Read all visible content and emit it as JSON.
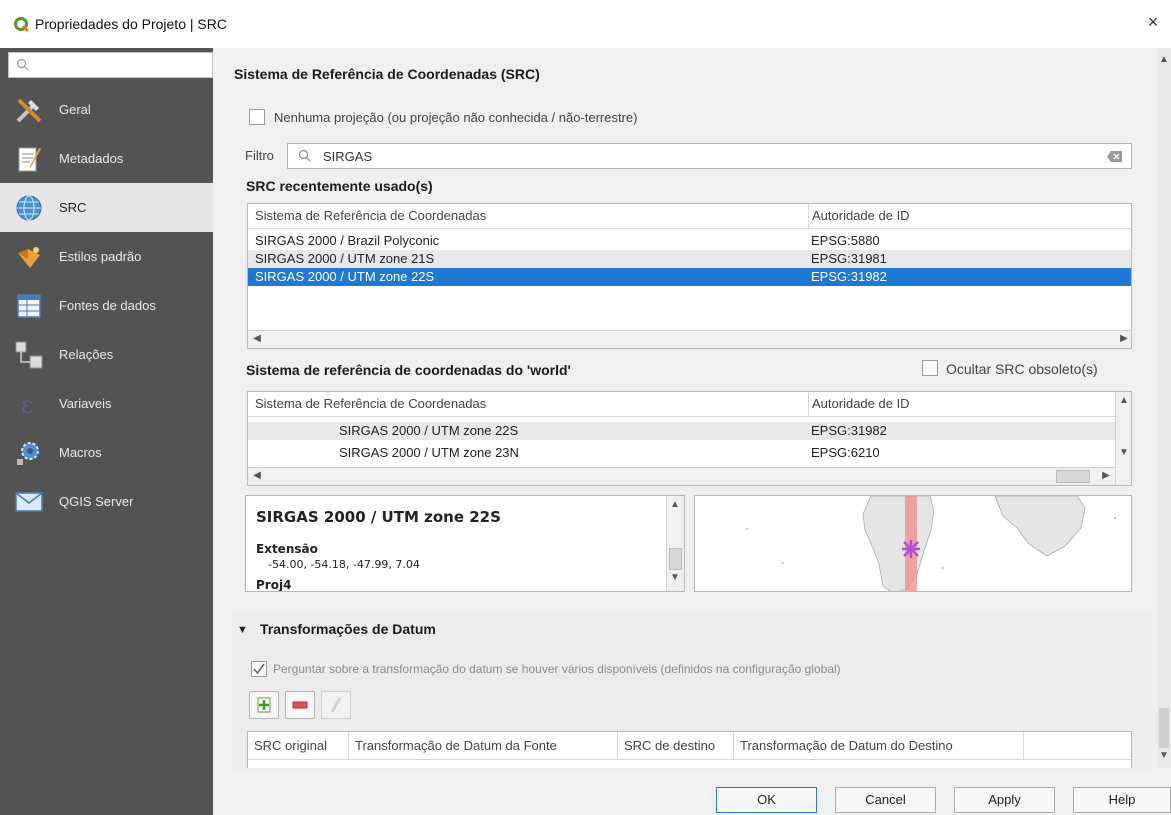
{
  "window": {
    "title": "Propriedades do Projeto | SRC",
    "close_label": "×"
  },
  "sidebar": {
    "items": [
      {
        "label": "Geral",
        "icon": "tools-icon"
      },
      {
        "label": "Metadados",
        "icon": "document-pen-icon"
      },
      {
        "label": "SRC",
        "icon": "globe-icon",
        "active": true
      },
      {
        "label": "Estilos padrão",
        "icon": "paint-icon"
      },
      {
        "label": "Fontes de dados",
        "icon": "table-icon"
      },
      {
        "label": "Relações",
        "icon": "relations-icon"
      },
      {
        "label": "Variaveis",
        "icon": "epsilon-icon"
      },
      {
        "label": "Macros",
        "icon": "gear-icon"
      },
      {
        "label": "QGIS Server",
        "icon": "server-icon"
      }
    ]
  },
  "src": {
    "section_title": "Sistema de Referência de Coordenadas (SRC)",
    "no_projection_label": "Nenhuma projeção (ou projeção não conhecida / não-terrestre)",
    "filter_label": "Filtro",
    "filter_value": "SIRGAS",
    "recent_title": "SRC recentemente usado(s)",
    "recent_columns": [
      "Sistema de Referência de Coordenadas",
      "Autoridade de ID"
    ],
    "recent_rows": [
      {
        "name": "SIRGAS 2000 / Brazil Polyconic",
        "id": "EPSG:5880"
      },
      {
        "name": "SIRGAS 2000 / UTM zone 21S",
        "id": "EPSG:31981"
      },
      {
        "name": "SIRGAS 2000 / UTM zone 22S",
        "id": "EPSG:31982"
      }
    ],
    "world_title": "Sistema de referência de coordenadas do 'world'",
    "hide_obsolete_label": "Ocultar SRC obsoleto(s)",
    "world_columns": [
      "Sistema de Referência de Coordenadas",
      "Autoridade de ID"
    ],
    "world_rows": [
      {
        "name": "SIRGAS 2000 / UTM zone 22S",
        "id": "EPSG:31982"
      },
      {
        "name": "SIRGAS 2000 / UTM zone 23N",
        "id": "EPSG:6210"
      }
    ],
    "info": {
      "title": "SIRGAS 2000 / UTM zone 22S",
      "extent_label": "Extensão",
      "extent_value": "-54.00, -54.18, -47.99, 7.04",
      "proj_label": "Proj4"
    }
  },
  "datum": {
    "title": "Transformações de Datum",
    "ask_label": "Perguntar sobre a transformação do datum se houver vários disponíveis (definidos na configuração global)",
    "columns": [
      "SRC original",
      "Transformação de Datum da Fonte",
      "SRC de destino",
      "Transformação de Datum do Destino"
    ]
  },
  "buttons": {
    "ok": "OK",
    "cancel": "Cancel",
    "apply": "Apply",
    "help": "Help"
  },
  "colors": {
    "sidebar_bg": "#535353",
    "selection": "#1f78d1",
    "utm_zone_band": "#f28b82"
  }
}
